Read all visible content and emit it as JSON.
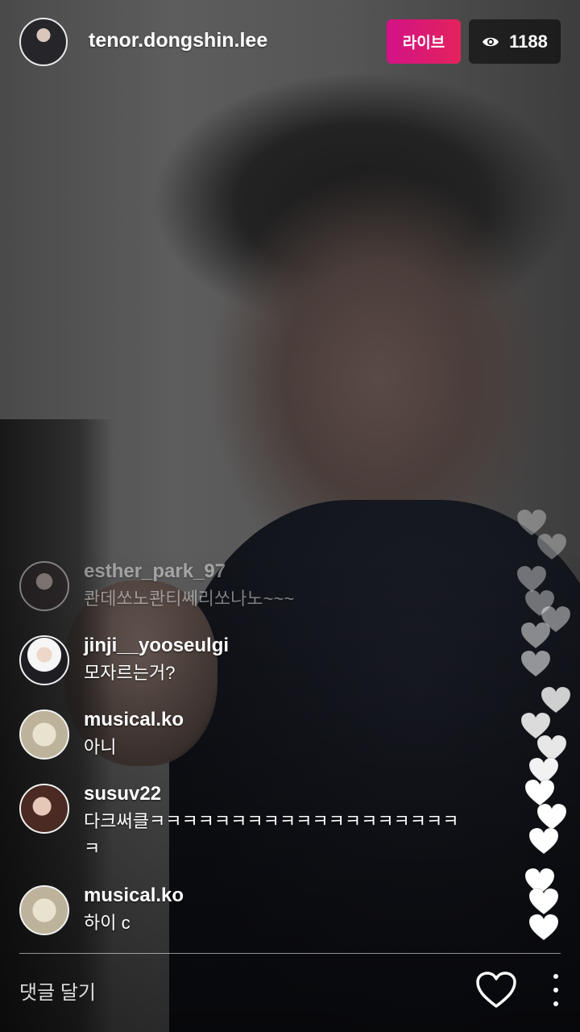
{
  "header": {
    "host_name": "tenor.dongshin.lee",
    "live_label": "라이브",
    "viewer_icon": "eye-icon",
    "viewer_count": "1188"
  },
  "comments": [
    {
      "user": "esther_park_97",
      "text": "콴데쏘노콴티쎄리쏘나노~~~"
    },
    {
      "user": "jinji__yooseulgi",
      "text": "모자르는거?"
    },
    {
      "user": "musical.ko",
      "text": "아니"
    },
    {
      "user": "susuv22",
      "text": "다크써클ㅋㅋㅋㅋㅋㅋㅋㅋㅋㅋㅋㅋㅋㅋㅋㅋㅋㅋㅋㅋ"
    },
    {
      "user": "musical.ko",
      "text": "하이 c"
    }
  ],
  "footer": {
    "comment_placeholder": "댓글 달기",
    "like_icon": "heart-outline-icon",
    "more_icon": "more-vertical-icon"
  },
  "colors": {
    "live_badge": "#d31287",
    "heart_fill": "#ffffff"
  }
}
